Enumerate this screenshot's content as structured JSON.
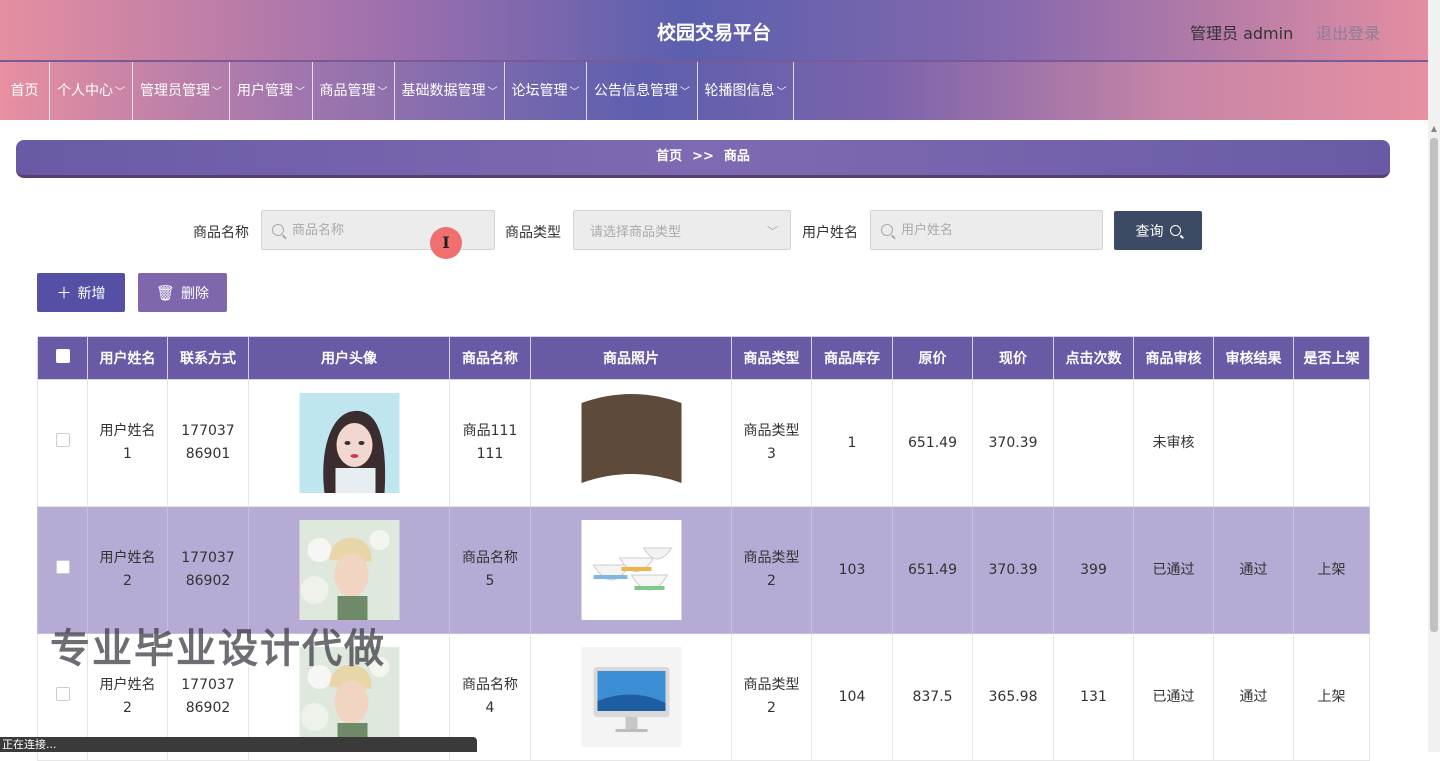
{
  "header": {
    "title": "校园交易平台",
    "admin": "管理员 admin",
    "logout": "退出登录"
  },
  "nav": [
    {
      "label": "首页",
      "dropdown": false
    },
    {
      "label": "个人中心",
      "dropdown": true
    },
    {
      "label": "管理员管理",
      "dropdown": true
    },
    {
      "label": "用户管理",
      "dropdown": true
    },
    {
      "label": "商品管理",
      "dropdown": true
    },
    {
      "label": "基础数据管理",
      "dropdown": true
    },
    {
      "label": "论坛管理",
      "dropdown": true
    },
    {
      "label": "公告信息管理",
      "dropdown": true
    },
    {
      "label": "轮播图信息",
      "dropdown": true
    }
  ],
  "breadcrumb": {
    "home": "首页",
    "separator": ">>",
    "current": "商品"
  },
  "search": {
    "name_label": "商品名称",
    "name_placeholder": "商品名称",
    "type_label": "商品类型",
    "type_placeholder": "请选择商品类型",
    "user_label": "用户姓名",
    "user_placeholder": "用户姓名",
    "query_label": "查询"
  },
  "actions": {
    "add_label": "新增",
    "delete_label": "删除"
  },
  "table": {
    "headers": [
      "用户姓名",
      "联系方式",
      "用户头像",
      "商品名称",
      "商品照片",
      "商品类型",
      "商品库存",
      "原价",
      "现价",
      "点击次数",
      "商品审核",
      "审核结果",
      "是否上架"
    ],
    "rows": [
      {
        "user_name": "用户姓名1",
        "phone": "17703786901",
        "avatar": "avatar-woman",
        "name": "商品111111",
        "photo": "photo-brown",
        "type": "商品类型3",
        "stock": "1",
        "orig_price": "651.49",
        "price": "370.39",
        "clicks": "",
        "audit": "未审核",
        "result": "",
        "on_shelf": "",
        "highlighted": false
      },
      {
        "user_name": "用户姓名2",
        "phone": "17703786902",
        "avatar": "avatar-man",
        "name": "商品名称5",
        "photo": "photo-bowls",
        "type": "商品类型2",
        "stock": "103",
        "orig_price": "651.49",
        "price": "370.39",
        "clicks": "399",
        "audit": "已通过",
        "result": "通过",
        "on_shelf": "上架",
        "highlighted": true
      },
      {
        "user_name": "用户姓名2",
        "phone": "17703786902",
        "avatar": "avatar-man",
        "name": "商品名称4",
        "photo": "photo-monitor",
        "type": "商品类型2",
        "stock": "104",
        "orig_price": "837.5",
        "price": "365.98",
        "clicks": "131",
        "audit": "已通过",
        "result": "通过",
        "on_shelf": "上架",
        "highlighted": false
      }
    ]
  },
  "watermark": "专业毕业设计代做",
  "status_text": "正在连接..."
}
